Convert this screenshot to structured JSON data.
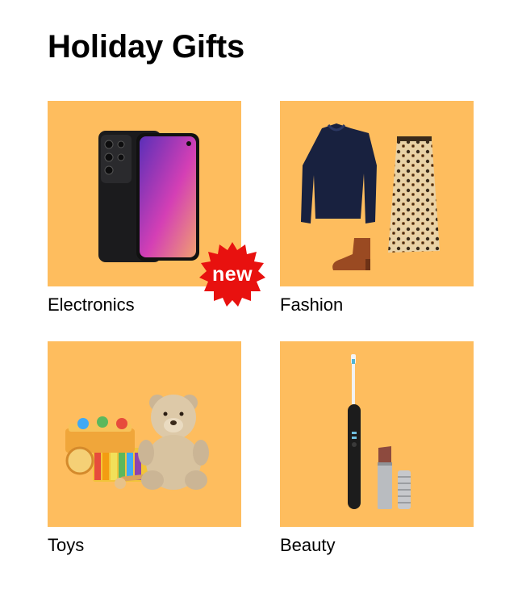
{
  "page": {
    "title": "Holiday Gifts"
  },
  "colors": {
    "tile_bg": "#FEBD5E",
    "badge": "#E8110F",
    "text": "#000000"
  },
  "categories": [
    {
      "label": "Electronics",
      "image": "smartphones-image",
      "badge": "new"
    },
    {
      "label": "Fashion",
      "image": "sweater-skirt-boot-image"
    },
    {
      "label": "Toys",
      "image": "teddy-bear-xylophone-image"
    },
    {
      "label": "Beauty",
      "image": "toothbrush-lipstick-image"
    }
  ]
}
